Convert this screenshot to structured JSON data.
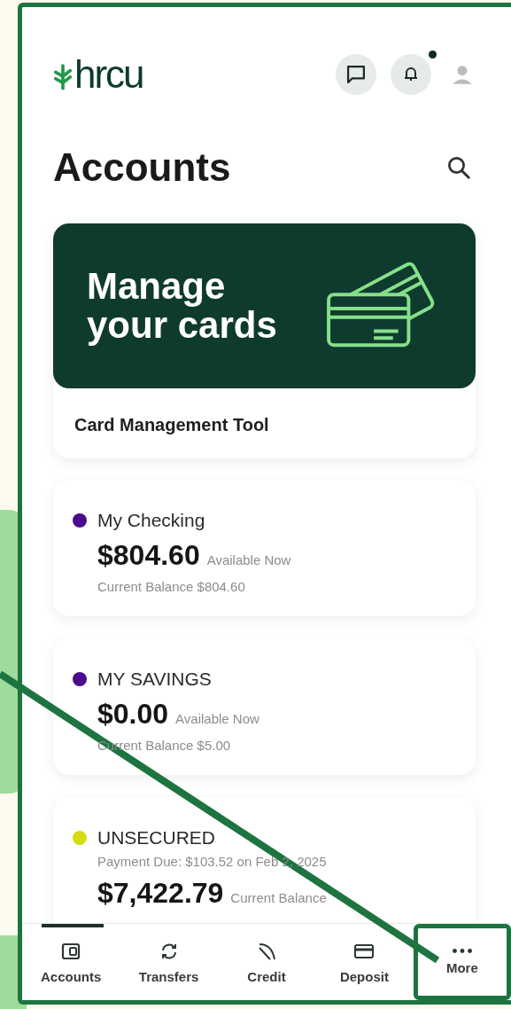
{
  "header": {
    "logo": "hrcu",
    "notifications_unread": true
  },
  "title": "Accounts",
  "promo": {
    "headline": [
      "Manage",
      "your cards"
    ],
    "caption": "Card Management Tool"
  },
  "accounts": [
    {
      "kind": "deposit",
      "name": "My Checking",
      "color": "#4b0a8c",
      "amount": "$804.60",
      "amount_label": "Available Now",
      "detail": "Current Balance $804.60"
    },
    {
      "kind": "deposit",
      "name": "MY SAVINGS",
      "color": "#4b0a8c",
      "amount": "$0.00",
      "amount_label": "Available Now",
      "detail": "Current Balance $5.00"
    },
    {
      "kind": "loan",
      "name": "UNSECURED",
      "color": "#d6dc12",
      "detail": "Payment Due: $103.52 on Feb 2, 2025",
      "amount": "$7,422.79",
      "amount_label": "Current Balance"
    }
  ],
  "tabs": [
    {
      "kind": "accounts",
      "label": "Accounts",
      "selected": true,
      "highlighted": false
    },
    {
      "kind": "transfers",
      "label": "Transfers",
      "selected": false,
      "highlighted": false
    },
    {
      "kind": "credit",
      "label": "Credit",
      "selected": false,
      "highlighted": false
    },
    {
      "kind": "deposit",
      "label": "Deposit",
      "selected": false,
      "highlighted": false
    },
    {
      "kind": "more",
      "label": "More",
      "selected": false,
      "highlighted": true
    }
  ]
}
